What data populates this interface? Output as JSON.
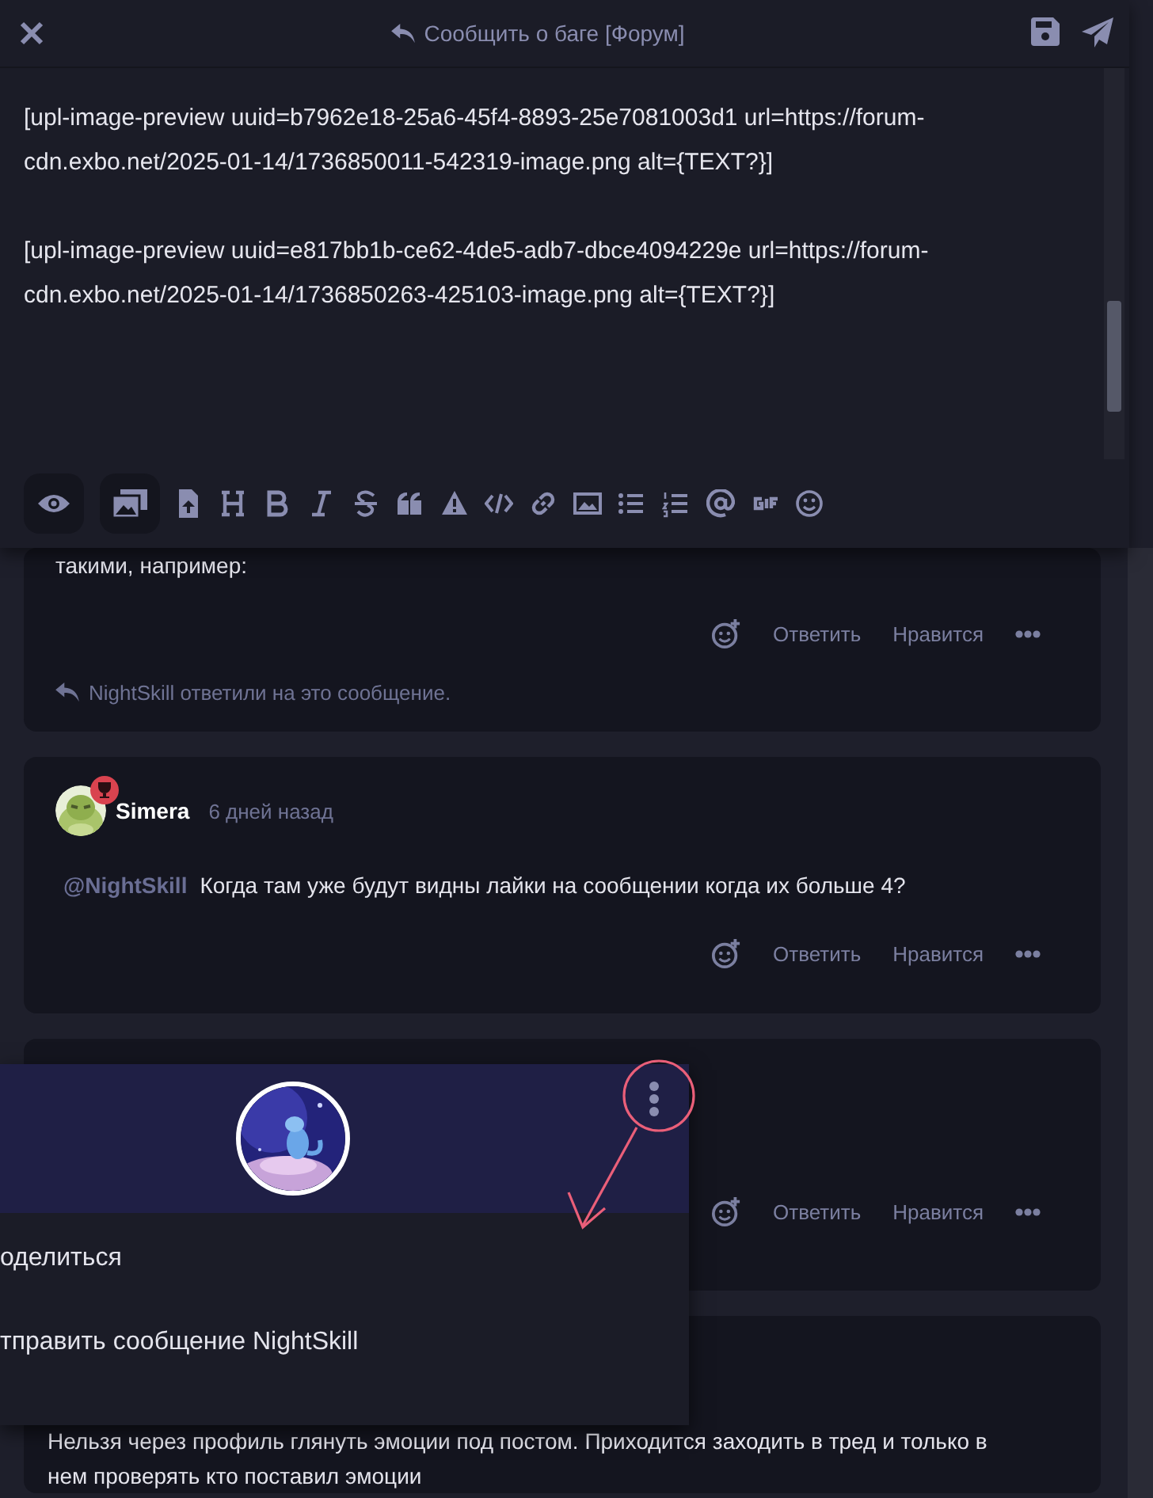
{
  "composer": {
    "title": "Сообщить о баге [Форум]",
    "paragraphs": [
      "[upl-image-preview uuid=b7962e18-25a6-45f4-8893-25e7081003d1 url=https://forum-cdn.exbo.net/2025-01-14/1736850011-542319-image.png alt={TEXT?}]",
      "[upl-image-preview uuid=e817bb1b-ce62-4de5-adb7-dbce4094229e url=https://forum-cdn.exbo.net/2025-01-14/1736850263-425103-image.png alt={TEXT?}]"
    ]
  },
  "posts": [
    {
      "kind": "tail",
      "body": "такими, например:",
      "actions": [
        "Ответить",
        "Нравится"
      ],
      "reply_note": "NightSkill ответили на это сообщение."
    },
    {
      "kind": "post",
      "author": "Simera",
      "time": "6 дней назад",
      "mention": "@NightSkill",
      "body": "Когда там уже будут видны лайки на сообщении когда их больше 4?",
      "actions": [
        "Ответить",
        "Нравится"
      ]
    },
    {
      "kind": "covered",
      "actions": [
        "Ответить",
        "Нравится"
      ]
    },
    {
      "kind": "text",
      "body": "Нельзя через профиль глянуть эмоции под постом. Приходится заходить в тред и только в нем проверять кто поставил эмоции"
    }
  ],
  "profile_popup": {
    "menu": [
      "оделиться",
      "тправить сообщение NightSkill"
    ]
  }
}
